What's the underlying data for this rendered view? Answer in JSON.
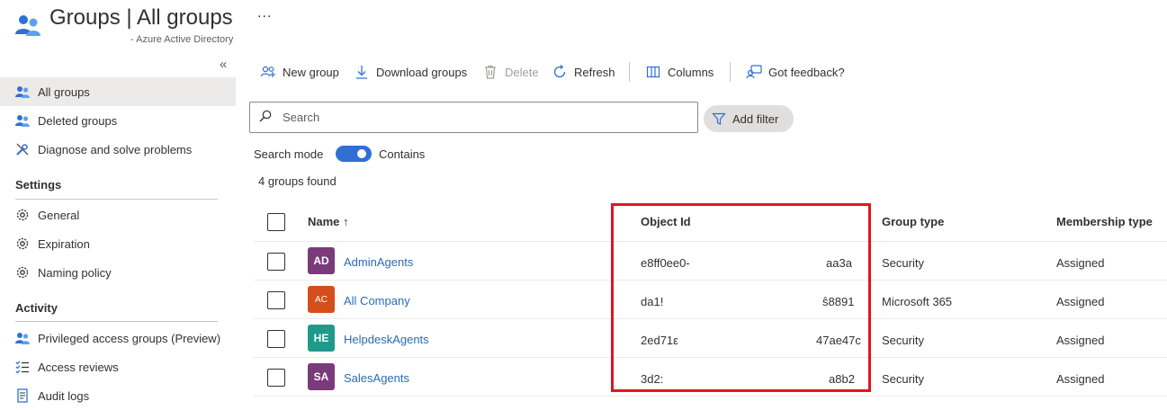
{
  "header": {
    "title": "Groups | All groups",
    "subtitle": "- Azure Active Directory",
    "more": "..."
  },
  "sidebar": {
    "collapse": "«",
    "items": [
      {
        "label": "All groups",
        "icon": "groups-icon",
        "active": true
      },
      {
        "label": "Deleted groups",
        "icon": "groups-icon"
      },
      {
        "label": "Diagnose and solve problems",
        "icon": "wrench-icon"
      }
    ],
    "sections": [
      {
        "title": "Settings",
        "items": [
          {
            "label": "General",
            "icon": "gear-icon"
          },
          {
            "label": "Expiration",
            "icon": "gear-icon"
          },
          {
            "label": "Naming policy",
            "icon": "gear-icon"
          }
        ]
      },
      {
        "title": "Activity",
        "items": [
          {
            "label": "Privileged access groups (Preview)",
            "icon": "groups-icon"
          },
          {
            "label": "Access reviews",
            "icon": "checklist-icon"
          },
          {
            "label": "Audit logs",
            "icon": "log-icon"
          }
        ]
      }
    ]
  },
  "toolbar": {
    "new_group": "New group",
    "download_groups": "Download groups",
    "delete": "Delete",
    "refresh": "Refresh",
    "columns": "Columns",
    "feedback": "Got feedback?"
  },
  "search": {
    "placeholder": "Search",
    "add_filter": "Add filter",
    "mode_label": "Search mode",
    "mode_value": "Contains",
    "result_count": "4 groups found"
  },
  "table": {
    "columns": {
      "name": "Name ↑",
      "object_id": "Object Id",
      "group_type": "Group type",
      "membership_type": "Membership type"
    },
    "rows": [
      {
        "initials": "AD",
        "avatar_color": "#7a3b7a",
        "name": "AdminAgents",
        "oid_start": "e8ff0ee0-",
        "oid_end": "aa3a",
        "group_type": "Security",
        "membership_type": "Assigned"
      },
      {
        "initials": "AC",
        "avatar_color": "#d64e1b",
        "name": "All Company",
        "oid_start": "da1!",
        "oid_end": "ŝ8891",
        "group_type": "Microsoft 365",
        "membership_type": "Assigned"
      },
      {
        "initials": "HE",
        "avatar_color": "#1f9a8a",
        "name": "HelpdeskAgents",
        "oid_start": "2ed71ε",
        "oid_end": "47ae47c",
        "group_type": "Security",
        "membership_type": "Assigned"
      },
      {
        "initials": "SA",
        "avatar_color": "#7a3b7a",
        "name": "SalesAgents",
        "oid_start": "3d2:",
        "oid_end": "a8b2",
        "group_type": "Security",
        "membership_type": "Assigned"
      }
    ]
  },
  "colors": {
    "accent": "#2f6fd6",
    "link": "#2b6cb0",
    "highlight": "#e0161e"
  }
}
